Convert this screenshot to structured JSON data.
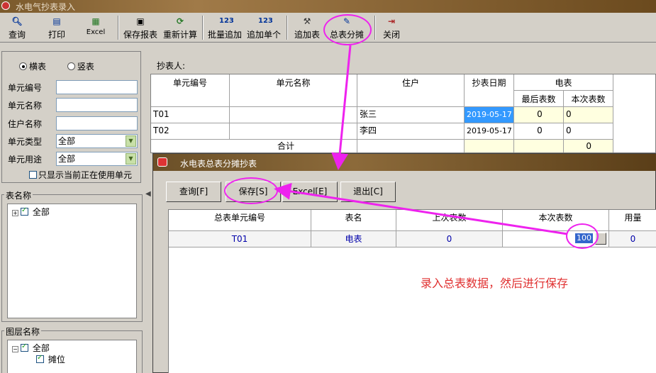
{
  "window": {
    "title": "水电气抄表录入"
  },
  "toolbar": {
    "items": [
      {
        "label": "查询",
        "icon": "search-icon"
      },
      {
        "label": "打印",
        "icon": "printer-icon"
      },
      {
        "label": "Excel",
        "icon": "excel-icon"
      },
      {
        "label": "保存报表",
        "icon": "save-icon"
      },
      {
        "label": "重新计算",
        "icon": "recalc-icon"
      },
      {
        "label": "批量追加",
        "icon": "123-icon"
      },
      {
        "label": "追加单个",
        "icon": "123-icon"
      },
      {
        "label": "追加表",
        "icon": "add-meter-icon"
      },
      {
        "label": "总表分摊",
        "icon": "allocate-icon"
      },
      {
        "label": "关闭",
        "icon": "exit-icon"
      }
    ]
  },
  "left_panel": {
    "radio_horizontal": "横表",
    "radio_vertical": "竖表",
    "unit_no_label": "单元编号",
    "unit_name_label": "单元名称",
    "tenant_label": "住户名称",
    "unit_type_label": "单元类型",
    "unit_type_value": "全部",
    "unit_use_label": "单元用途",
    "unit_use_value": "全部",
    "only_active_label": "只显示当前正在使用单元",
    "meter_group_title": "表名称",
    "meter_tree_root": "全部",
    "floor_group_title": "图层名称",
    "floor_tree_root": "全部",
    "floor_tree_child": "摊位"
  },
  "main": {
    "collector_label": "抄表人:",
    "columns": {
      "unit_no": "单元编号",
      "unit_name": "单元名称",
      "tenant": "住户",
      "date": "抄表日期",
      "meter_group": "电表",
      "last_reading": "最后表数",
      "current_reading": "本次表数"
    },
    "rows": [
      {
        "unit_no": "T01",
        "unit_name": "",
        "tenant": "张三",
        "date": "2019-05-17",
        "last": "0",
        "current": "0"
      },
      {
        "unit_no": "T02",
        "unit_name": "",
        "tenant": "李四",
        "date": "2019-05-17",
        "last": "0",
        "current": "0"
      }
    ],
    "total_label": "合计",
    "total_current": "0"
  },
  "dialog": {
    "title": "水电表总表分摊抄表",
    "buttons": {
      "query": "查询[F]",
      "save": "保存[S]",
      "excel": "Excel[E]",
      "exit": "退出[C]"
    },
    "columns": {
      "unit_no": "总表单元编号",
      "meter_name": "表名",
      "last_reading": "上次表数",
      "current_reading": "本次表数",
      "usage": "用量"
    },
    "row": {
      "unit_no": "T01",
      "meter_name": "电表",
      "last_reading": "0",
      "current_reading": "100",
      "usage": "0"
    }
  },
  "annotation": {
    "text": "录入总表数据，然后进行保存",
    "color": "#e03030",
    "marker_color": "#ee22ee"
  }
}
